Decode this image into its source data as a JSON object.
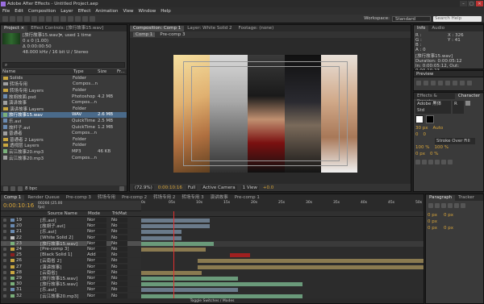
{
  "app": {
    "title": "Adobe After Effects - Untitled Project.aep",
    "min": "–",
    "max": "□",
    "close": "✕"
  },
  "menu": [
    "File",
    "Edit",
    "Composition",
    "Layer",
    "Effect",
    "Animation",
    "View",
    "Window",
    "Help"
  ],
  "toolbar": {
    "workspace_label": "Workspace:",
    "workspace_value": "Standard",
    "search_placeholder": "Search Help"
  },
  "project": {
    "tabs": [
      "Project ×",
      "Effect Controls: [旅行故事15.wav]"
    ],
    "file_name": "[旅行故事15.wav]▾, used 1 time",
    "file_info1": "0 x 0 (1.00)",
    "file_info2": "Δ 0:00:00:50",
    "audio_info": "48.000 kHz / 16 bit U / Stereo",
    "search_placeholder": "⌕",
    "cols": {
      "name": "Name",
      "type": "Type",
      "size": "Size",
      "frame": "Fr..."
    },
    "items": [
      {
        "name": "Solids",
        "type": "Folder",
        "size": "",
        "color": "#c9a640",
        "folder": true
      },
      {
        "name": "转场专用",
        "type": "Compos...n",
        "size": "",
        "color": "#a0a0a0",
        "folder": true
      },
      {
        "name": "转场专用 Layers",
        "type": "Folder",
        "size": "",
        "color": "#c9a640",
        "folder": true
      },
      {
        "name": "故胡故面.psd",
        "type": "Photoshop",
        "size": "4.2 MB",
        "color": "#6a8ab0",
        "folder": false
      },
      {
        "name": "演讲故事",
        "type": "Compos...n",
        "size": "",
        "color": "#a0a0a0",
        "folder": false
      },
      {
        "name": "演讲故事 Layers",
        "type": "Folder",
        "size": "",
        "color": "#c9a640",
        "folder": true
      },
      {
        "name": "旅行故事15.wav",
        "type": "WAV",
        "size": "2.6 MB",
        "color": "#7ab07a",
        "folder": false,
        "sel": true
      },
      {
        "name": "乐.avi",
        "type": "QuickTime",
        "size": "2.5 MB",
        "color": "#6a8ab0",
        "folder": false
      },
      {
        "name": "故杆子.avi",
        "type": "QuickTime",
        "size": "1.2 MB",
        "color": "#6a8ab0",
        "folder": false
      },
      {
        "name": "普通者",
        "type": "Compos...n",
        "size": "",
        "color": "#a0a0a0",
        "folder": false
      },
      {
        "name": "普通者 2 Layers",
        "type": "Folder",
        "size": "",
        "color": "#c9a640",
        "folder": true
      },
      {
        "name": "透视层 Layers",
        "type": "Folder",
        "size": "",
        "color": "#c9a640",
        "folder": true
      },
      {
        "name": "云江故事20.mp3",
        "type": "MP3",
        "size": "46 KB",
        "color": "#7ab07a",
        "folder": false
      },
      {
        "name": "云江故事20.mp3",
        "type": "Compos...n",
        "size": "",
        "color": "#a0a0a0",
        "folder": false
      }
    ],
    "bpc": "8 bpc"
  },
  "comp": {
    "tabs": [
      "Composition: Comp 1",
      "Layer: White Solid 2",
      "Footage: (none)"
    ],
    "sub_tabs": [
      "Comp 1",
      "Pre-comp 3"
    ],
    "zoom": "(72.9%)",
    "timecode": "0:00:10:16",
    "res": "Full",
    "camera": "Active Camera",
    "view": "1 View",
    "offset": "+0.0"
  },
  "info": {
    "tabs": [
      "Info",
      "Audio"
    ],
    "r": "R :",
    "g": "G :",
    "b": "B :",
    "a": "A : 0",
    "x": "X : 326",
    "y": "Y : 41",
    "layer": "[旅行故事15.wav]",
    "dur": "Duration: 0:00:05:12",
    "in": "In: 0:00:05:12, Out: 0:00:10:23"
  },
  "preview": {
    "label": "Preview"
  },
  "effects": {
    "label": "Effects & Presets",
    "char": "Character"
  },
  "char": {
    "font": "Adobe 黑体 Std",
    "style": "R",
    "size": "30 px",
    "leading": "Auto",
    "kerning": "0",
    "tracking": "0",
    "stroke": "Stroke Over Fill",
    "vscale": "100 %",
    "hscale": "100 %",
    "baseline": "0 px",
    "tsume": "0 %"
  },
  "timeline": {
    "tabs": [
      "Comp 1",
      "Render Queue",
      "Pre-comp 3",
      "转场专用",
      "Pre-comp 2",
      "转场专用 2",
      "转场专用 3",
      "演讲故事",
      "Pre-comp 1"
    ],
    "timecode": "0:00:10:16",
    "fps": "00266 (25.00 fps)",
    "col_source": "Source Name",
    "col_mode": "Mode",
    "col_trk": "TrkMat",
    "footer": "Toggle Switches / Modes",
    "ticks": [
      "0s",
      "05s",
      "10s",
      "15s",
      "20s",
      "25s",
      "30s",
      "35s",
      "40s",
      "45s",
      "50s"
    ],
    "layers": [
      {
        "num": "19",
        "name": "[乐.avi]",
        "mode": "Nor",
        "trk": "No",
        "color": "#6a8ab0",
        "hl": false
      },
      {
        "num": "20",
        "name": "[故胡子.avi]",
        "mode": "Nor",
        "trk": "No",
        "color": "#6a8ab0",
        "hl": false
      },
      {
        "num": "21",
        "name": "[乐.avi]",
        "mode": "Nor",
        "trk": "No",
        "color": "#6a8ab0",
        "hl": false
      },
      {
        "num": "22",
        "name": "[White Solid 2]",
        "mode": "Nor",
        "trk": "No",
        "color": "#c0c0c0",
        "hl": false
      },
      {
        "num": "23",
        "name": "[旅行故事15.wav]",
        "mode": "Nor",
        "trk": "No",
        "color": "#7ab07a",
        "hl": true
      },
      {
        "num": "24",
        "name": "[Pre-comp 3]",
        "mode": "Nor",
        "trk": "No",
        "color": "#c9a640",
        "hl": false
      },
      {
        "num": "25",
        "name": "[Black Solid 1]",
        "mode": "Add",
        "trk": "No",
        "color": "#8b2020",
        "hl": false
      },
      {
        "num": "26",
        "name": "[云南省 2]",
        "mode": "Nor",
        "trk": "No",
        "color": "#c9a640",
        "hl": false
      },
      {
        "num": "27",
        "name": "[演讲故事]",
        "mode": "Nor",
        "trk": "No",
        "color": "#c9a640",
        "hl": false
      },
      {
        "num": "28",
        "name": "[云南省]",
        "mode": "Nor",
        "trk": "No",
        "color": "#c9a640",
        "hl": false
      },
      {
        "num": "29",
        "name": "[旅行故事15.wav]",
        "mode": "Nor",
        "trk": "No",
        "color": "#7ab07a",
        "hl": false
      },
      {
        "num": "30",
        "name": "[旅行故事15.wav]",
        "mode": "Nor",
        "trk": "No",
        "color": "#7ab07a",
        "hl": false
      },
      {
        "num": "31",
        "name": "[乐.avi]",
        "mode": "Nor",
        "trk": "No",
        "color": "#6a8ab0",
        "hl": false
      },
      {
        "num": "32",
        "name": "[云江故事20.mp3]",
        "mode": "Nor",
        "trk": "No",
        "color": "#7ab07a",
        "hl": false
      }
    ]
  },
  "paragraph": {
    "tabs": [
      "Paragraph",
      "Tracker"
    ],
    "vals": [
      "0 px",
      "0 px",
      "0 px",
      "0 px",
      "0 px"
    ]
  }
}
